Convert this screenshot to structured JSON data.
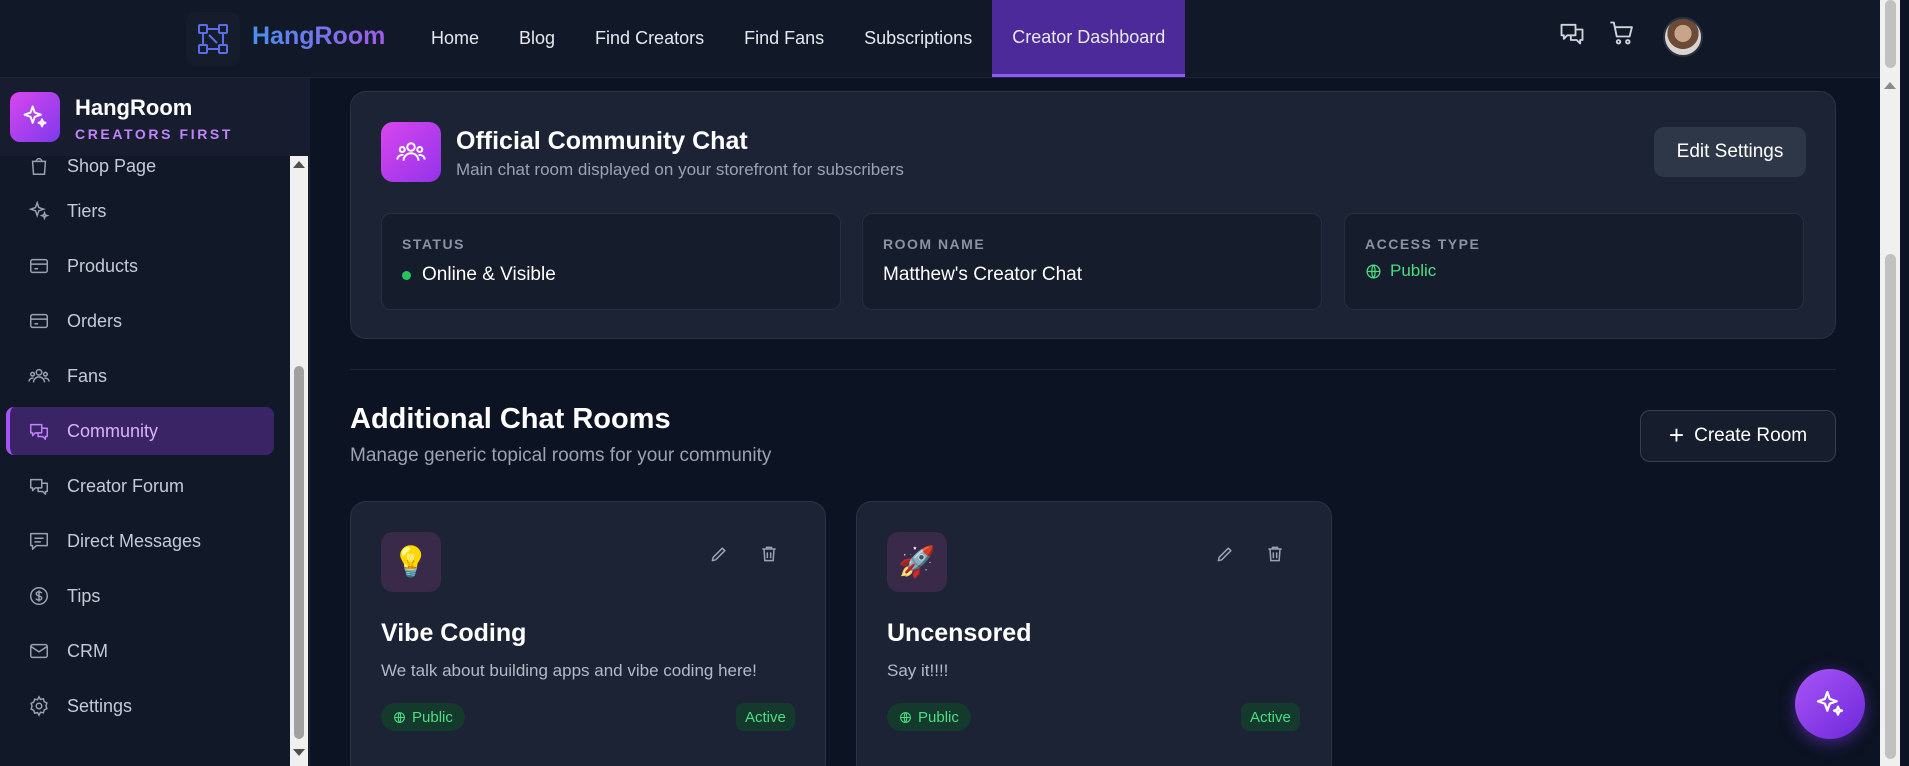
{
  "topbar": {
    "brand": "HangRoom",
    "nav": [
      {
        "label": "Home"
      },
      {
        "label": "Blog"
      },
      {
        "label": "Find Creators"
      },
      {
        "label": "Find Fans"
      },
      {
        "label": "Subscriptions"
      },
      {
        "label": "Creator Dashboard",
        "active": true
      }
    ],
    "icons": [
      "chat-icon",
      "cart-icon"
    ]
  },
  "sidebar": {
    "title": "HangRoom",
    "subtitle": "CREATORS FIRST",
    "items": [
      {
        "label": "Shop Page",
        "icon": "bag-icon"
      },
      {
        "label": "Tiers",
        "icon": "sparkles-icon"
      },
      {
        "label": "Products",
        "icon": "card-icon"
      },
      {
        "label": "Orders",
        "icon": "card-icon"
      },
      {
        "label": "Fans",
        "icon": "users-icon"
      },
      {
        "label": "Community",
        "icon": "chat-icon",
        "active": true
      },
      {
        "label": "Creator Forum",
        "icon": "chat-icon"
      },
      {
        "label": "Direct Messages",
        "icon": "message-icon"
      },
      {
        "label": "Tips",
        "icon": "dollar-icon"
      },
      {
        "label": "CRM",
        "icon": "mail-icon"
      },
      {
        "label": "Settings",
        "icon": "gear-icon"
      }
    ]
  },
  "official": {
    "title": "Official Community Chat",
    "description": "Main chat room displayed on your storefront for subscribers",
    "edit_label": "Edit Settings",
    "status_label": "STATUS",
    "status_value": "Online & Visible",
    "room_name_label": "ROOM NAME",
    "room_name_value": "Matthew's Creator Chat",
    "access_label": "ACCESS TYPE",
    "access_value": "Public"
  },
  "additional": {
    "title": "Additional Chat Rooms",
    "description": "Manage generic topical rooms for your community",
    "create_label": "Create Room",
    "rooms": [
      {
        "emoji": "💡",
        "name": "Vibe Coding",
        "description": "We talk about building apps and vibe coding here!",
        "access": "Public",
        "status": "Active"
      },
      {
        "emoji": "🚀",
        "name": "Uncensored",
        "description": "Say it!!!!",
        "access": "Public",
        "status": "Active"
      }
    ]
  },
  "colors": {
    "accent": "#8b5cf6",
    "active_nav_bg": "#4c2a9a",
    "success": "#4ade80",
    "background": "#0c1322"
  }
}
